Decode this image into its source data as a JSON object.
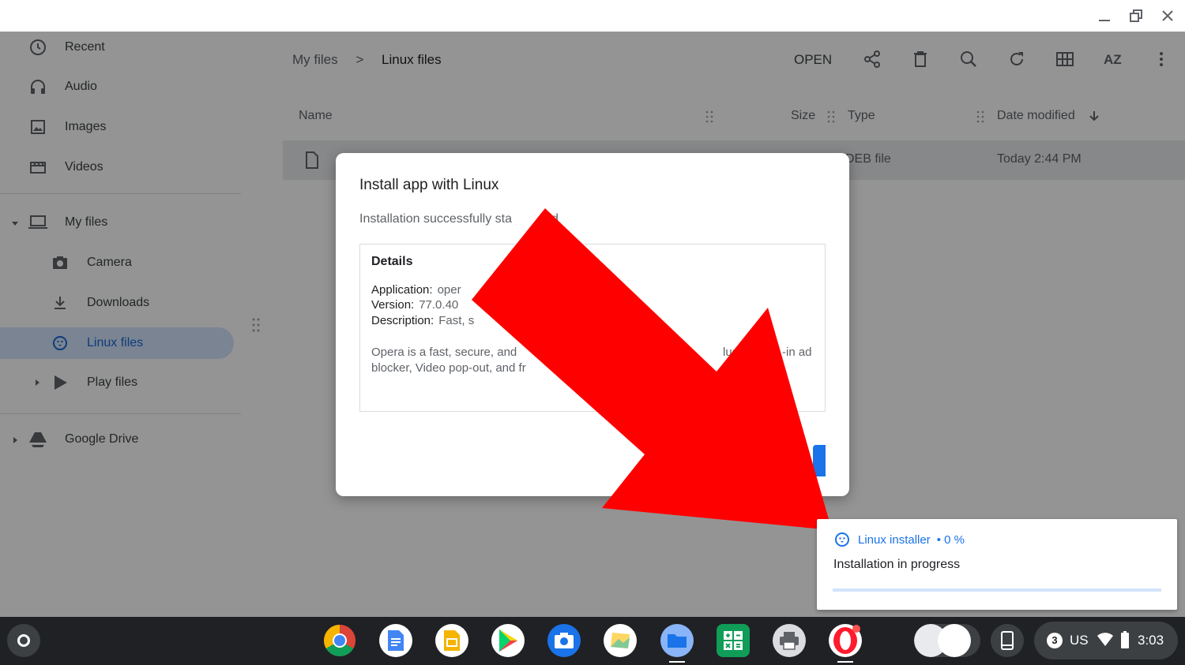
{
  "window": {
    "controls": [
      "minimize",
      "maximize",
      "close"
    ]
  },
  "sidebar": {
    "items": [
      {
        "label": "Recent",
        "icon": "clock-icon"
      },
      {
        "label": "Audio",
        "icon": "headphones-icon"
      },
      {
        "label": "Images",
        "icon": "image-icon"
      },
      {
        "label": "Videos",
        "icon": "film-icon"
      },
      {
        "label": "My files",
        "icon": "laptop-icon"
      },
      {
        "label": "Camera",
        "icon": "camera-icon"
      },
      {
        "label": "Downloads",
        "icon": "download-icon"
      },
      {
        "label": "Linux files",
        "icon": "penguin-icon"
      },
      {
        "label": "Play files",
        "icon": "play-icon"
      },
      {
        "label": "Google Drive",
        "icon": "drive-icon"
      }
    ]
  },
  "breadcrumb": {
    "root": "My files",
    "sep": ">",
    "current": "Linux files"
  },
  "toolbar": {
    "open_label": "OPEN",
    "sort_label": "AZ"
  },
  "table": {
    "columns": [
      "Name",
      "Size",
      "Type",
      "Date modified"
    ],
    "row": {
      "type": "DEB file",
      "date": "Today 2:44 PM"
    }
  },
  "dialog": {
    "title": "Install app with Linux",
    "status": "Installation successfully sta",
    "status_tail": "d",
    "details_heading": "Details",
    "app_key": "Application:",
    "app_val": "oper",
    "version_key": "Version:",
    "version_val": "77.0.40",
    "desc_key": "Description:",
    "desc_val": "Fast, s",
    "body_l1a": "Opera is a fast, secure, and",
    "body_l1b": "lud",
    "body_l1c": "-in ad",
    "body_l2": "blocker, Video pop-out, and fr"
  },
  "notification": {
    "source": "Linux installer",
    "percent": "• 0 %",
    "progress": 0,
    "message": "Installation in progress"
  },
  "shelf": {
    "apps": [
      "chrome-icon",
      "docs-icon",
      "slides-icon",
      "play-store-icon",
      "camera-app-icon",
      "gallery-icon",
      "files-icon",
      "calculator-icon",
      "printer-icon",
      "opera-icon"
    ],
    "tray": {
      "badge": "3",
      "keyboard": "US",
      "time": "3:03"
    }
  },
  "colors": {
    "accent": "#1a73e8",
    "arrow": "#ff0000",
    "shelf": "#202124"
  }
}
